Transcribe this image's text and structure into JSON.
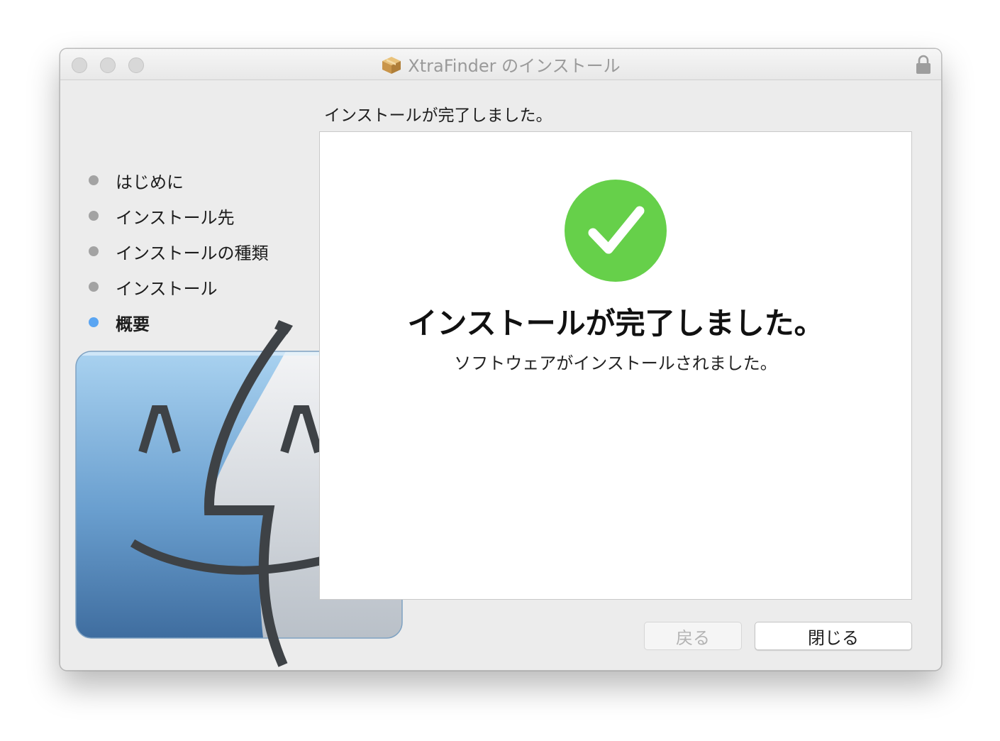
{
  "window": {
    "title": "XtraFinder のインストール",
    "title_icon": "package-icon",
    "lock_icon": "lock-icon"
  },
  "section_heading": "インストールが完了しました。",
  "steps": [
    {
      "label": "はじめに",
      "active": false
    },
    {
      "label": "インストール先",
      "active": false
    },
    {
      "label": "インストールの種類",
      "active": false
    },
    {
      "label": "インストール",
      "active": false
    },
    {
      "label": "概要",
      "active": true
    }
  ],
  "content": {
    "status_icon": "checkmark-icon",
    "title": "インストールが完了しました。",
    "subtitle": "ソフトウェアがインストールされました。"
  },
  "buttons": {
    "back_label": "戻る",
    "back_enabled": false,
    "close_label": "閉じる"
  },
  "colors": {
    "success_green": "#66d04a",
    "active_step": "#5aa5f2",
    "inactive_step": "#a3a3a3"
  }
}
